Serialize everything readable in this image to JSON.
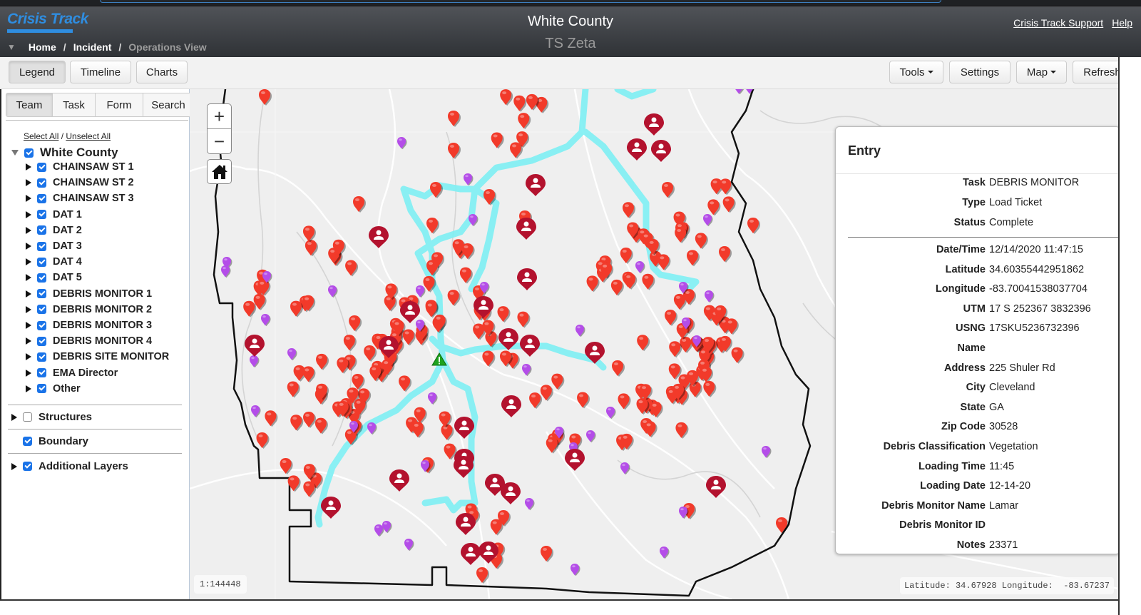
{
  "app": {
    "logo": "Crisis Track",
    "title": "White County",
    "subtitle": "TS Zeta",
    "links": [
      "Crisis Track Support",
      "Help"
    ]
  },
  "breadcrumb": [
    "Home",
    "Incident",
    "Operations View"
  ],
  "toolbar": {
    "left": [
      "Legend",
      "Timeline",
      "Charts"
    ],
    "right": [
      "Tools",
      "Settings",
      "Map",
      "Refresh"
    ],
    "active": "Legend"
  },
  "sidebar": {
    "tabs": [
      "Team",
      "Task",
      "Form",
      "Search"
    ],
    "active_tab": "Team",
    "select_all": "Select All",
    "unselect_all": "Unselect All",
    "root": {
      "label": "White County",
      "checked": true,
      "expanded": true
    },
    "teams": [
      {
        "label": "CHAINSAW ST 1",
        "checked": true
      },
      {
        "label": "CHAINSAW ST 2",
        "checked": true
      },
      {
        "label": "CHAINSAW ST 3",
        "checked": true
      },
      {
        "label": "DAT 1",
        "checked": true
      },
      {
        "label": "DAT 2",
        "checked": true
      },
      {
        "label": "DAT 3",
        "checked": true
      },
      {
        "label": "DAT 4",
        "checked": true
      },
      {
        "label": "DAT 5",
        "checked": true
      },
      {
        "label": "DEBRIS MONITOR 1",
        "checked": true
      },
      {
        "label": "DEBRIS MONITOR 2",
        "checked": true
      },
      {
        "label": "DEBRIS MONITOR 3",
        "checked": true
      },
      {
        "label": "DEBRIS MONITOR 4",
        "checked": true
      },
      {
        "label": "DEBRIS SITE MONITOR",
        "checked": true
      },
      {
        "label": "EMA Director",
        "checked": true
      },
      {
        "label": "Other",
        "checked": true
      }
    ],
    "layers": [
      {
        "label": "Structures",
        "checked": false,
        "expandable": true
      },
      {
        "label": "Boundary",
        "checked": true,
        "expandable": false
      },
      {
        "label": "Additional Layers",
        "checked": true,
        "expandable": true
      }
    ]
  },
  "map": {
    "scale": "1:144448",
    "cursor_coords": "Latitude: 34.67928 Longitude:  -83.67237",
    "colors": {
      "red_pin": "#f23a2a",
      "purple_pin": "#b44de8",
      "person_pin": "#b3122e",
      "route": "#7ef0f4",
      "boundary": "#111111",
      "warning": "#1ea31e"
    }
  },
  "entry": {
    "title": "Entry",
    "summary": [
      {
        "label": "Task",
        "value": "DEBRIS MONITOR"
      },
      {
        "label": "Type",
        "value": "Load Ticket"
      },
      {
        "label": "Status",
        "value": "Complete"
      }
    ],
    "fields": [
      {
        "label": "Date/Time",
        "value": "12/14/2020 11:47:15"
      },
      {
        "label": "Latitude",
        "value": "34.60355442951862"
      },
      {
        "label": "Longitude",
        "value": "-83.70041538037704"
      },
      {
        "label": "UTM",
        "value": "17 S 252367 3832396"
      },
      {
        "label": "USNG",
        "value": "17SKU5236732396"
      },
      {
        "label": "Name",
        "value": ""
      },
      {
        "label": "Address",
        "value": "225 Shuler Rd"
      },
      {
        "label": "City",
        "value": "Cleveland"
      },
      {
        "label": "State",
        "value": "GA"
      },
      {
        "label": "Zip Code",
        "value": "30528"
      },
      {
        "label": "Debris Classification",
        "value": "Vegetation"
      },
      {
        "label": "Loading Time",
        "value": "11:45"
      },
      {
        "label": "Loading Date",
        "value": "12-14-20"
      },
      {
        "label": "Debris Monitor Name",
        "value": "Lamar"
      },
      {
        "label": "Debris Monitor ID",
        "value": ""
      },
      {
        "label": "Notes",
        "value": "23371"
      }
    ]
  }
}
